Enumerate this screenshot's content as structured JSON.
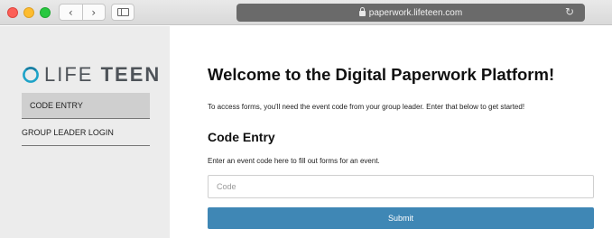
{
  "browser": {
    "url": "paperwork.lifeteen.com",
    "back_glyph": "‹",
    "forward_glyph": "›",
    "reload_glyph": "↻",
    "icons": [
      "close-dot",
      "minimize-dot",
      "zoom-dot",
      "back-icon",
      "forward-icon",
      "sidebar-toggle-icon",
      "lock-icon",
      "reload-icon"
    ],
    "colors": {
      "close": "#fc5f57",
      "minimize": "#fdbc2e",
      "zoom": "#28c840"
    }
  },
  "sidebar": {
    "logo": {
      "word1": "LIFE",
      "word2": "TEEN"
    },
    "items": [
      {
        "label": "CODE ENTRY",
        "active": true
      },
      {
        "label": "GROUP LEADER LOGIN",
        "active": false
      }
    ]
  },
  "main": {
    "title": "Welcome to the Digital Paperwork Platform!",
    "intro": "To access forms, you'll need the event code from your group leader. Enter that below to get started!",
    "section_title": "Code Entry",
    "hint": "Enter an event code here to fill out forms for an event.",
    "code_input": {
      "placeholder": "Code",
      "value": ""
    },
    "submit_label": "Submit",
    "accent_color": "#3f87b5"
  }
}
